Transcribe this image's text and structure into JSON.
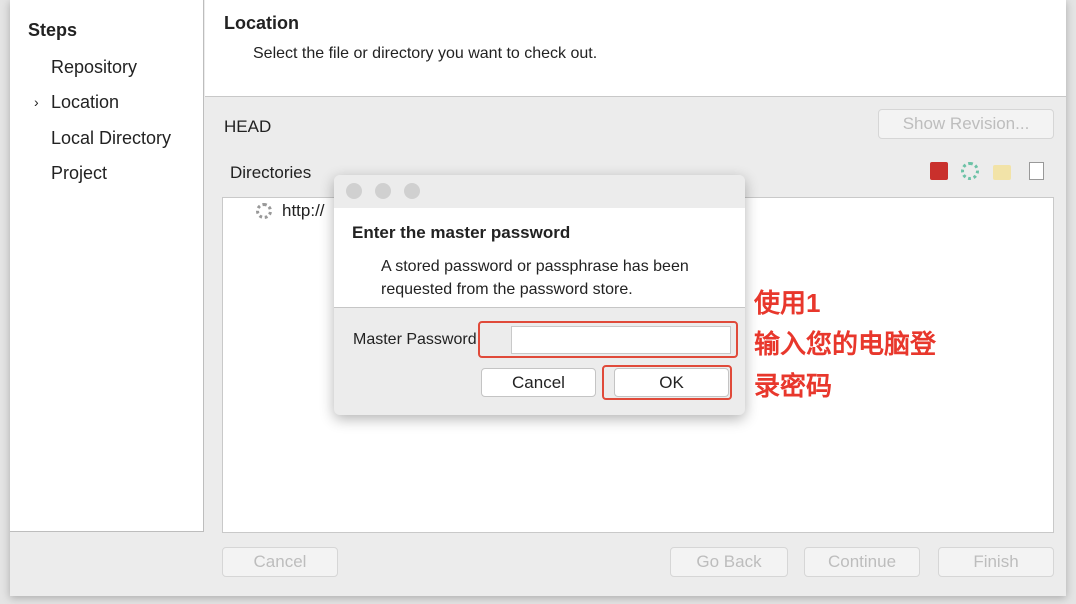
{
  "sidebar": {
    "title": "Steps",
    "items": [
      {
        "label": "Repository"
      },
      {
        "label": "Location",
        "current": true
      },
      {
        "label": "Local Directory"
      },
      {
        "label": "Project"
      }
    ]
  },
  "header": {
    "title": "Location",
    "description": "Select the file or directory you want to check out."
  },
  "main": {
    "head_label": "HEAD",
    "show_revision": "Show Revision...",
    "directories_label": "Directories",
    "tree_item": "http://",
    "toolbar_icons": [
      "stop-icon",
      "refresh-icon",
      "folder-add-icon",
      "new-file-icon"
    ]
  },
  "footer": {
    "cancel": "Cancel",
    "go_back": "Go Back",
    "continue": "Continue",
    "finish": "Finish"
  },
  "dialog": {
    "title": "Enter the master password",
    "description": "A stored password or passphrase has been requested from the password store.",
    "field_label": "Master Password:",
    "field_value": "",
    "cancel": "Cancel",
    "ok": "OK"
  },
  "annotation": {
    "lines": [
      "使用1",
      "输入您的电脑登",
      "录密码"
    ],
    "color": "#e8372c"
  }
}
